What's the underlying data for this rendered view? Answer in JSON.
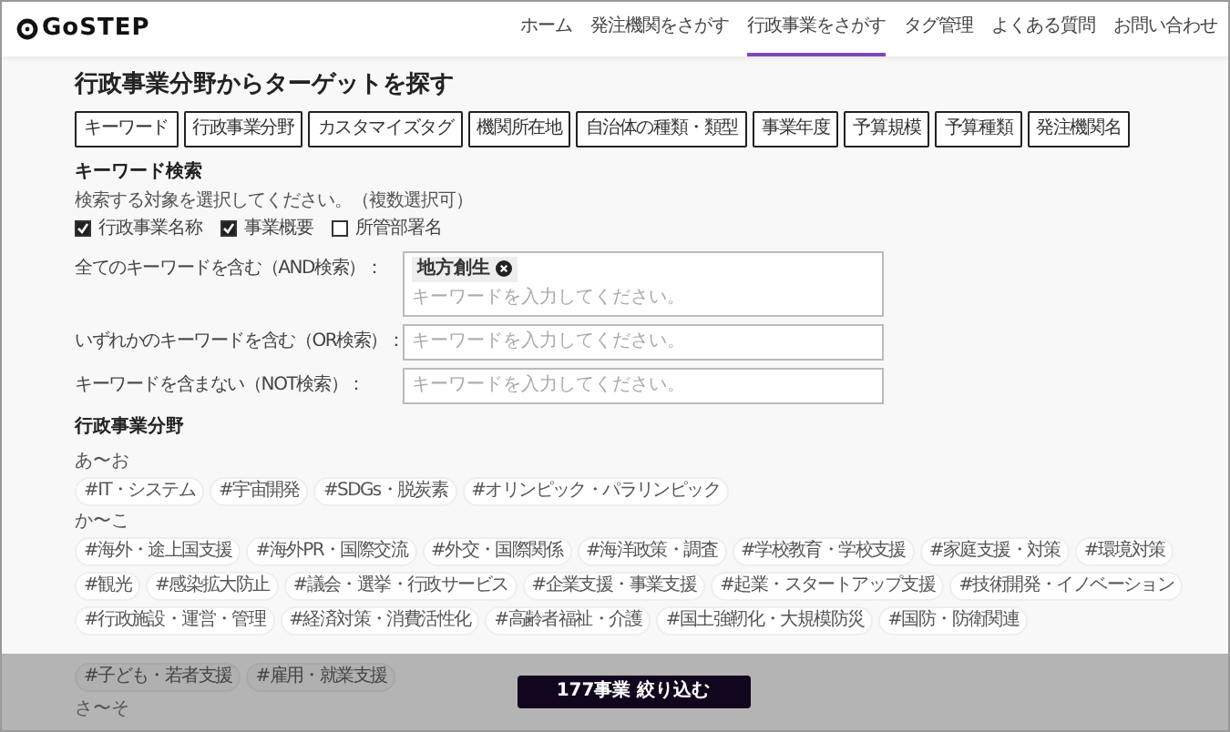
{
  "header": {
    "logo": "GoSTEP",
    "nav": [
      {
        "label": "ホーム",
        "selected": false
      },
      {
        "label": "発注機関をさがす",
        "selected": false
      },
      {
        "label": "行政事業をさがす",
        "selected": true
      },
      {
        "label": "タグ管理",
        "selected": false
      },
      {
        "label": "よくある質問",
        "selected": false
      },
      {
        "label": "お問い合わせ",
        "selected": false
      }
    ]
  },
  "title": "行政事業分野からターゲットを探す",
  "filter_tabs": [
    "キーワード",
    "行政事業分野",
    "カスタマイズタグ",
    "機関所在地",
    "自治体の種類・類型",
    "事業年度",
    "予算規模",
    "予算種類",
    "発注機関名"
  ],
  "keyword_search": {
    "heading": "キーワード検索",
    "hint": "検索する対象を選択してください。（複数選択可）",
    "targets": [
      {
        "label": "行政事業名称",
        "checked": true
      },
      {
        "label": "事業概要",
        "checked": true
      },
      {
        "label": "所管部署名",
        "checked": false
      }
    ],
    "fields": [
      {
        "label": "全てのキーワードを含む（AND検索）：",
        "tags": [
          "地方創生"
        ],
        "placeholder": "キーワードを入力してください。"
      },
      {
        "label": "いずれかのキーワードを含む（OR検索）：",
        "placeholder": "キーワードを入力してください。"
      },
      {
        "label": "キーワードを含まない（NOT検索）：",
        "placeholder": "キーワードを入力してください。"
      }
    ]
  },
  "fields_section": {
    "heading": "行政事業分野",
    "groups": [
      {
        "label": "あ〜お",
        "tags": [
          "#IT・システム",
          "#宇宙開発",
          "#SDGs・脱炭素",
          "#オリンピック・パラリンピック"
        ]
      },
      {
        "label": "か〜こ",
        "tags": [
          "#海外・途上国支援",
          "#海外PR・国際交流",
          "#外交・国際関係",
          "#海洋政策・調査",
          "#学校教育・学校支援",
          "#家庭支援・対策",
          "#環境対策",
          "#観光",
          "#感染拡大防止",
          "#議会・選挙・行政サービス",
          "#企業支援・事業支援",
          "#起業・スタートアップ支援",
          "#技術開発・イノベーション",
          "#行政施設・運営・管理",
          "#経済対策・消費活性化",
          "#高齢者福祉・介護",
          "#国土強靭化・大規模防災",
          "#国防・防衛関連"
        ]
      }
    ]
  },
  "overlay": {
    "tags": [
      "#子ども・若者支援",
      "#雇用・就業支援"
    ],
    "group_label": "さ〜そ",
    "button": "177事業 絞り込む"
  }
}
